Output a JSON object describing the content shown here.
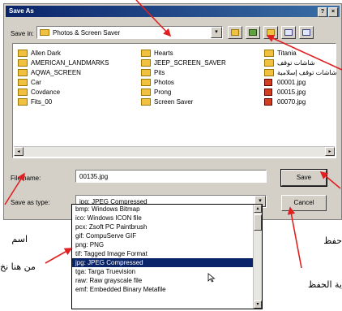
{
  "dialog": {
    "title": "Save As",
    "title_buttons": [
      "?",
      "×"
    ],
    "save_in_label": "Save in:",
    "save_in_value": "Photos & Screen Saver",
    "dropdown_arrow": "▾",
    "toolbar_icons": [
      "up-folder-icon",
      "new-folder-icon",
      "desktop-icon",
      "view-menu-icon",
      "view-list-icon"
    ]
  },
  "files": {
    "col1": [
      {
        "type": "folder",
        "name": "Allen Dark"
      },
      {
        "type": "folder",
        "name": "AMERICAN_LANDMARKS"
      },
      {
        "type": "folder",
        "name": "AQWA_SCREEN"
      },
      {
        "type": "folder",
        "name": "Car"
      },
      {
        "type": "folder",
        "name": "Covdance"
      },
      {
        "type": "folder",
        "name": "Fits_00"
      }
    ],
    "col2": [
      {
        "type": "folder",
        "name": "Hearts"
      },
      {
        "type": "folder",
        "name": "JEEP_SCREEN_SAVER"
      },
      {
        "type": "folder",
        "name": "Pits"
      },
      {
        "type": "folder",
        "name": "Photos"
      },
      {
        "type": "folder",
        "name": "Prong"
      },
      {
        "type": "folder",
        "name": "Screen Saver"
      }
    ],
    "col3": [
      {
        "type": "folder",
        "name": "Titania"
      },
      {
        "type": "folder",
        "name": "شاشات توقف"
      },
      {
        "type": "folder",
        "name": "شاشات توقف إسلامية"
      },
      {
        "type": "jpg",
        "name": "00001.jpg"
      },
      {
        "type": "jpg",
        "name": "00015.jpg"
      },
      {
        "type": "jpg",
        "name": "00070.jpg"
      }
    ],
    "scroll_left": "◂",
    "scroll_right": "▸"
  },
  "file_name": {
    "label": "File name:",
    "value": "00135.jpg"
  },
  "save_as_type": {
    "label": "Save as type:",
    "value": "jpg: JPEG Compressed"
  },
  "buttons": {
    "save": "Save",
    "cancel": "Cancel"
  },
  "type_options": [
    {
      "label": "bmp: Windows Bitmap",
      "selected": false
    },
    {
      "label": "ico: Windows ICON file",
      "selected": false
    },
    {
      "label": "pcx: Zsoft PC Paintbrush",
      "selected": false
    },
    {
      "label": "gif: CompuServe GIF",
      "selected": false
    },
    {
      "label": "png: PNG",
      "selected": false
    },
    {
      "label": "tif: Tagged Image Format",
      "selected": false
    },
    {
      "label": "jpg: JPEG Compressed",
      "selected": true
    },
    {
      "label": "tga: Targa Truevision",
      "selected": false
    },
    {
      "label": "raw: Raw grayscale file",
      "selected": false
    },
    {
      "label": "emf: Embedded Binary Metafile",
      "selected": false
    }
  ],
  "callouts": {
    "name": "اسم",
    "choose": "من هنا نخ",
    "save": "حفظ",
    "save_type": "ية الحفظ"
  },
  "colors": {
    "arrow": "#e02020",
    "titlebar": "#0a246a",
    "selection": "#0a246a"
  }
}
